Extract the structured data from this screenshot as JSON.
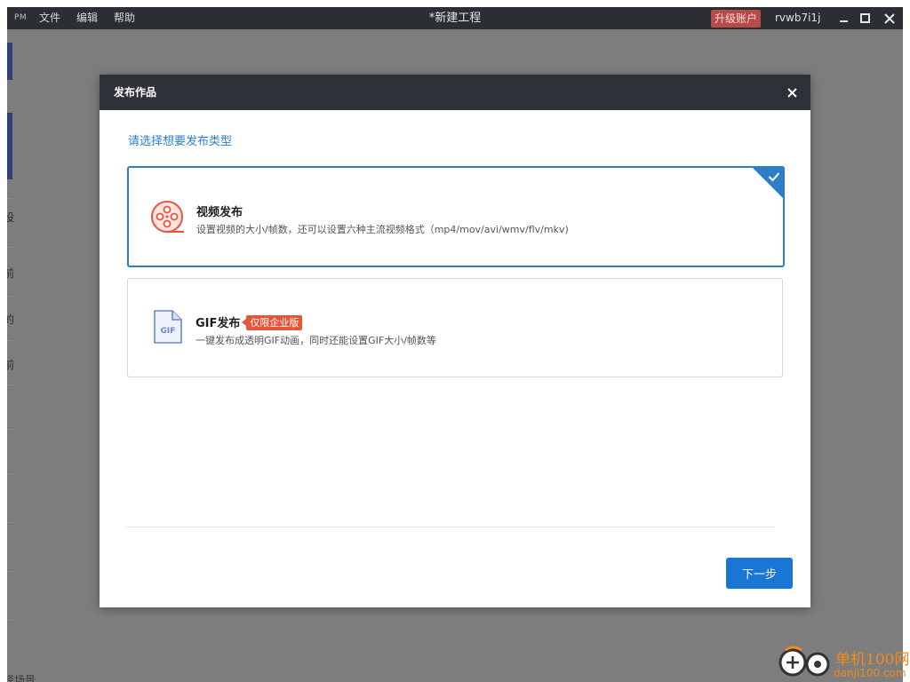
{
  "titlebar": {
    "logo": "PM",
    "menu": [
      "文件",
      "编辑",
      "帮助"
    ],
    "title": "*新建工程",
    "upgrade_label": "升级账户",
    "account": "rvwb7i1j"
  },
  "background": {
    "fragments": [
      "设",
      "前",
      "的",
      "前",
      "择场景"
    ]
  },
  "dialog": {
    "title": "发布作品",
    "prompt": "请选择想要发布类型",
    "options": [
      {
        "title": "视频发布",
        "description": "设置视频的大小/帧数，还可以设置六种主流视频格式（mp4/mov/avi/wmv/flv/mkv)",
        "selected": true,
        "icon": "film-reel-icon"
      },
      {
        "title": "GIF发布",
        "badge": "仅限企业版",
        "description": "一键发布成透明GIF动画，同时还能设置GIF大小/帧数等",
        "selected": false,
        "icon": "gif-file-icon",
        "icon_text": "GIF"
      }
    ],
    "next_label": "下一步"
  },
  "watermark": {
    "name": "单机100网",
    "url": "danji100.com"
  },
  "colors": {
    "accent": "#2d7ec9",
    "primary_button": "#1976d2",
    "badge": "#e8543a",
    "header": "#2e3137",
    "upgrade": "#b94a4a"
  }
}
